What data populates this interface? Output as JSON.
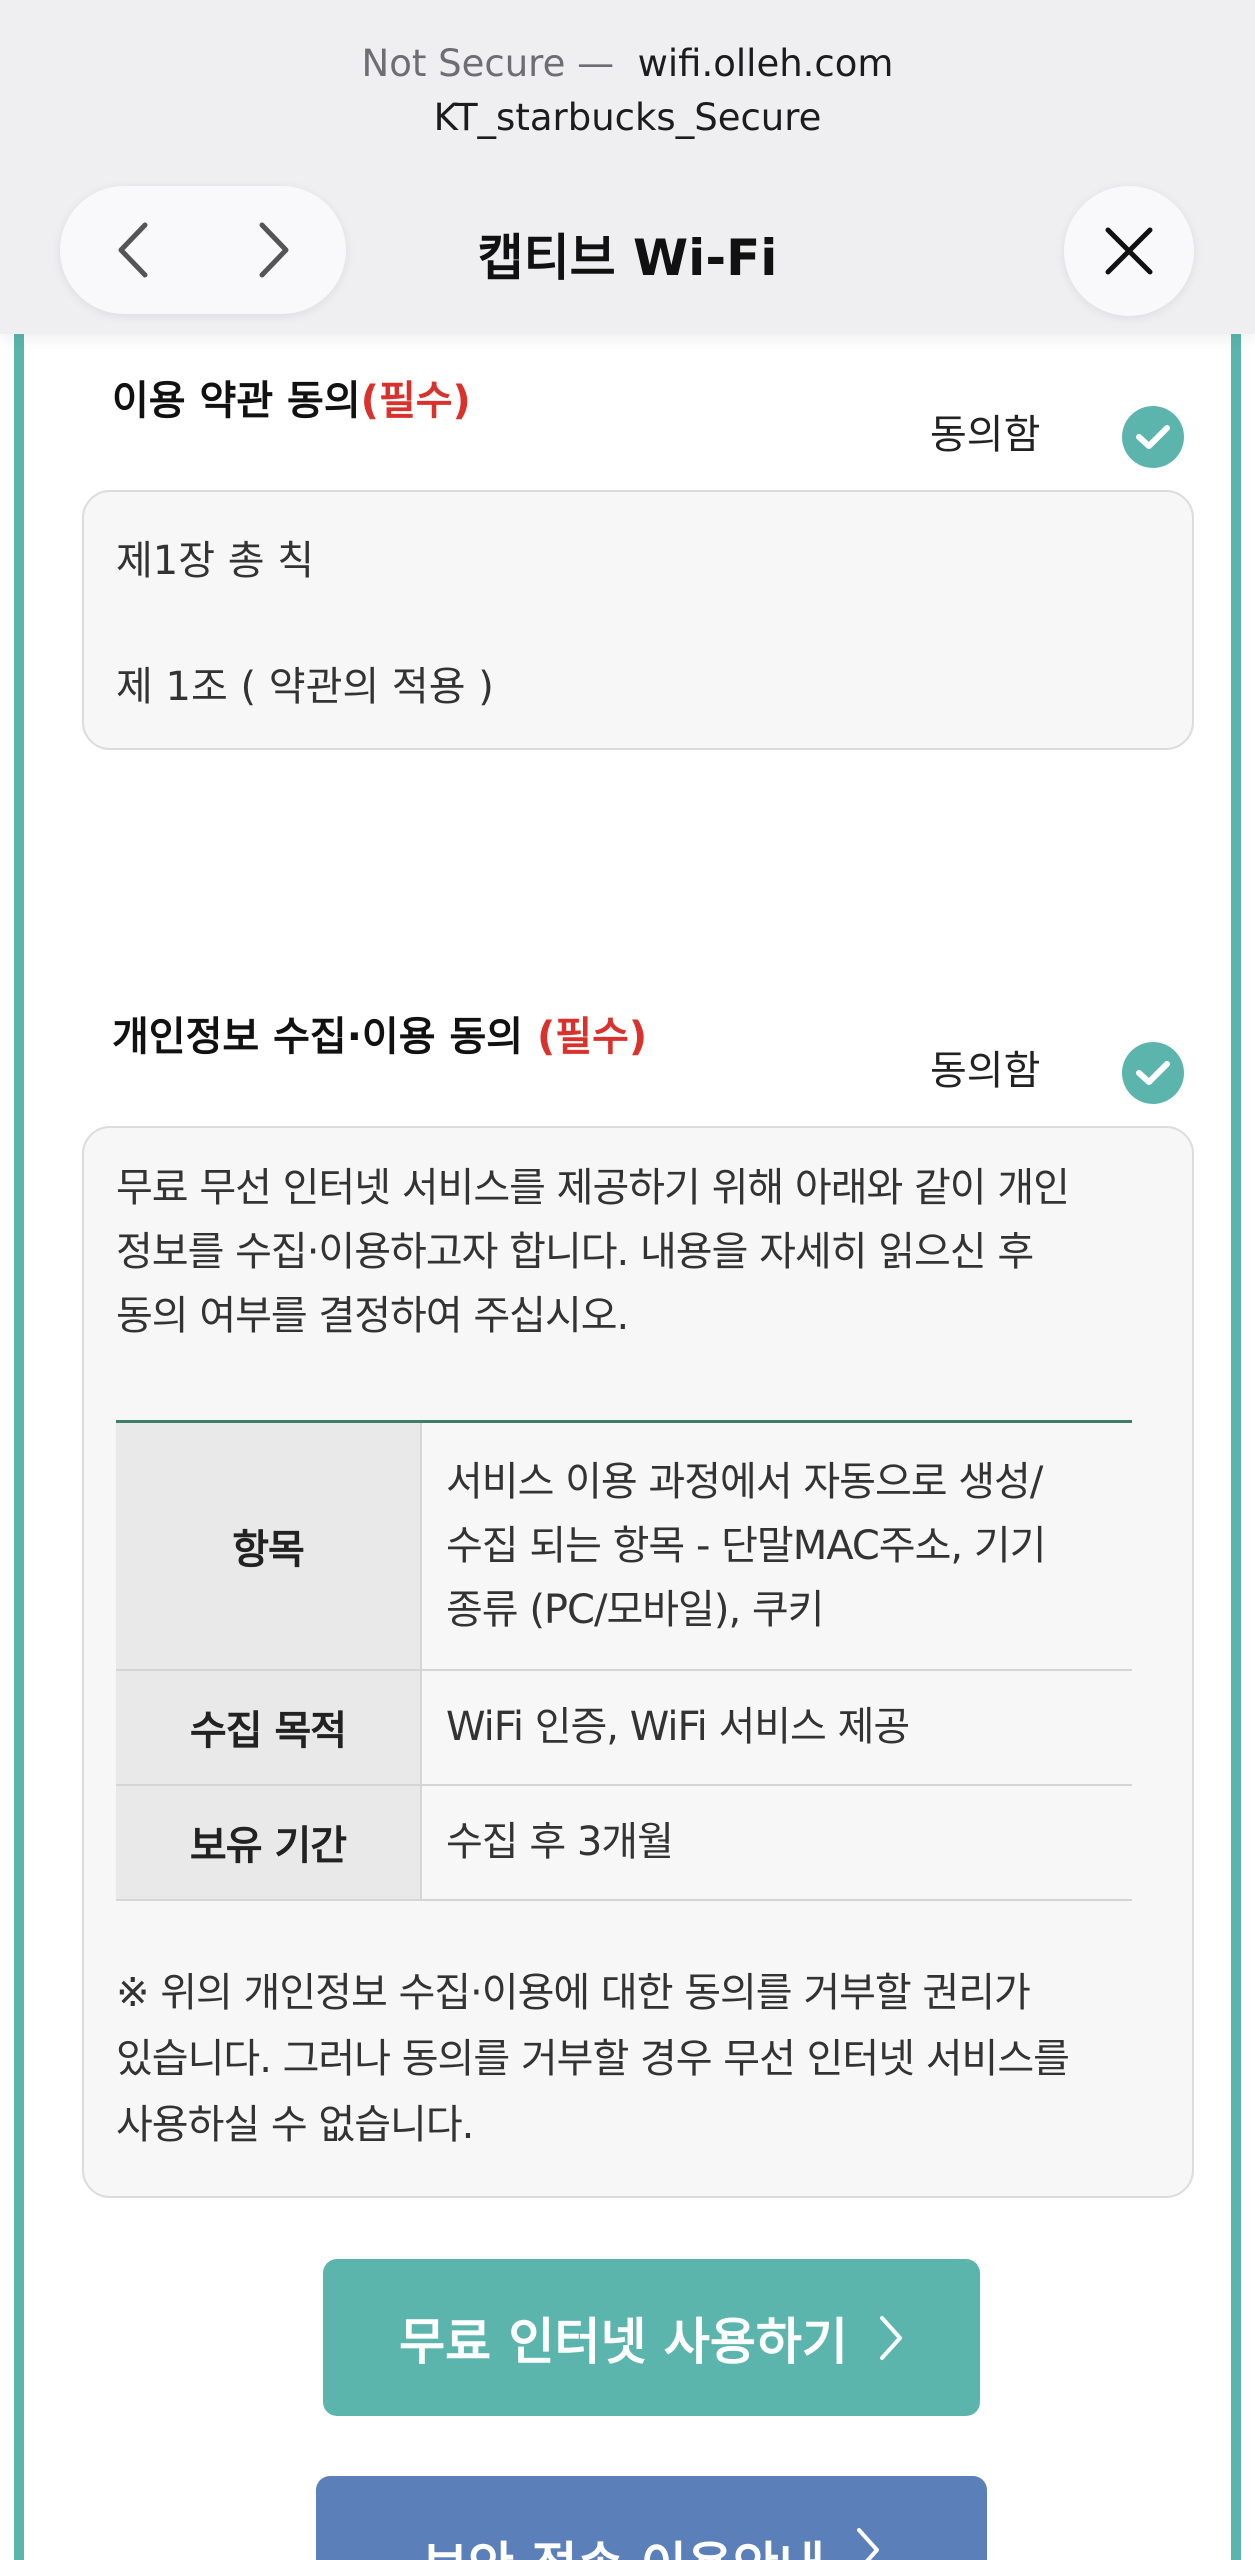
{
  "browser": {
    "security_label": "Not Secure —",
    "domain": "wifi.olleh.com",
    "ssid": "KT_starbucks_Secure",
    "sheet_title": "캡티브 Wi-Fi"
  },
  "terms": {
    "title": "이용 약관 동의",
    "required": "(필수)",
    "agree_label": "동의함",
    "lines": [
      "제1장 총 칙",
      "제 1조 ( 약관의 적용 )"
    ]
  },
  "privacy": {
    "title": "개인정보 수집·이용 동의",
    "required": "(필수)",
    "agree_label": "동의함",
    "intro": [
      "무료 무선 인터넷 서비스를 제공하기 위해 아래와 같이 개인",
      "정보를 수집·이용하고자 합니다. 내용을 자세히 읽으신 후",
      "동의 여부를 결정하여 주십시오."
    ],
    "table": [
      {
        "header": "항목",
        "value": [
          "서비스 이용 과정에서 자동으로 생성/",
          "수집 되는 항목 - 단말MAC주소, 기기",
          "종류 (PC/모바일), 쿠키"
        ]
      },
      {
        "header": "수집 목적",
        "value": [
          "WiFi 인증, WiFi 서비스 제공"
        ]
      },
      {
        "header": "보유 기간",
        "value": [
          "수집 후 3개월"
        ]
      }
    ],
    "note": [
      "※ 위의 개인정보 수집·이용에 대한 동의를 거부할 권리가",
      "있습니다. 그러나 동의를 거부할 경우 무선 인터넷 서비스를",
      "사용하실 수 없습니다."
    ]
  },
  "buttons": {
    "free_internet": "무료 인터넷 사용하기",
    "secure_guide": "보안 접속 이용안내"
  },
  "colors": {
    "accent": "#5bb5ad",
    "required": "#d9322d",
    "secondary": "#5b7fb8"
  }
}
